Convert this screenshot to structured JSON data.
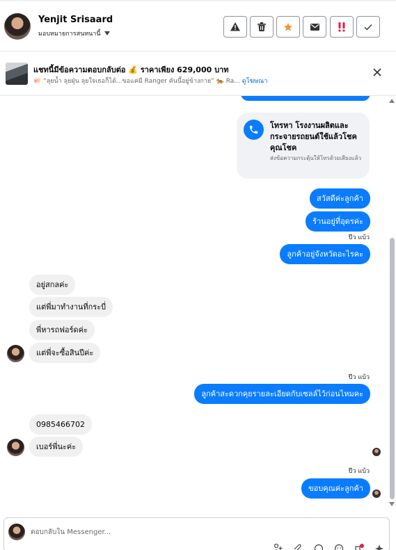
{
  "header": {
    "contact_name": "Yenjit Srisaard",
    "assign_label": "มอบหมายการสนทนานี้",
    "actions": [
      {
        "name": "report-button",
        "icon": "warning-icon"
      },
      {
        "name": "delete-button",
        "icon": "trash-icon"
      },
      {
        "name": "star-button",
        "icon": "star-icon",
        "color": "#f7913d"
      },
      {
        "name": "mark-unread-button",
        "icon": "envelope-icon"
      },
      {
        "name": "follow-up-button",
        "icon": "double-exclamation-icon",
        "color": "#e41e3f"
      },
      {
        "name": "mark-done-button",
        "icon": "check-icon"
      }
    ]
  },
  "ad": {
    "title": "แชทนี้มีข้อความตอบกลับต่อ 💰 ราคาเพียง 629,000 บาท",
    "subtitle": "🐖 “ลุยน้ำ ลุยฝุ่น ลุยใจเธอก็ได้...ขอแค่มี Ranger คันนี้อยู่ข้างกาย” 🐅 Ra...",
    "link": "ดูโฆษณา"
  },
  "call_card": {
    "title": "โทรหา โรงงานผลิตและกระจายรถยนต์ใช้แล้วโชคคุณโชค",
    "subtitle": "ส่งข้อความกระตุ้นให้โทรด้วยเสียงแล้ว"
  },
  "messages": {
    "m1": "สวัสดีค่ะลูกค้า",
    "m2": "ร้านอยู่ที่อุดรค่ะ",
    "meta1": "ปีว แบ้ว",
    "m3": "ลูกค้าอยู่จังหวัดอะไรคะ",
    "t1": "อยู่สกลค่ะ",
    "t2": "แต่พี่มาทำงานที่กระบี่",
    "t3": "พี่หารถฟอร์ดค่ะ",
    "t4": "แต่พี่จะซื้อสินปีค่ะ",
    "meta2": "ปีว แบ้ว",
    "m4": "ลูกค้าสะดวกคุยรายละเอียดกับเซลล์ไว้ก่อนไหมคะ",
    "t5": "0985466702",
    "t6": "เบอร์พี่นะค่ะ",
    "meta3": "ปีว แบ้ว",
    "m5": "ขอบคุณค่ะลูกค้า"
  },
  "composer": {
    "placeholder": "ตอบกลับใน Messenger..."
  },
  "colors": {
    "outgoing": "#0a7cff",
    "incoming": "#f0f0f0",
    "link": "#0064d1"
  }
}
